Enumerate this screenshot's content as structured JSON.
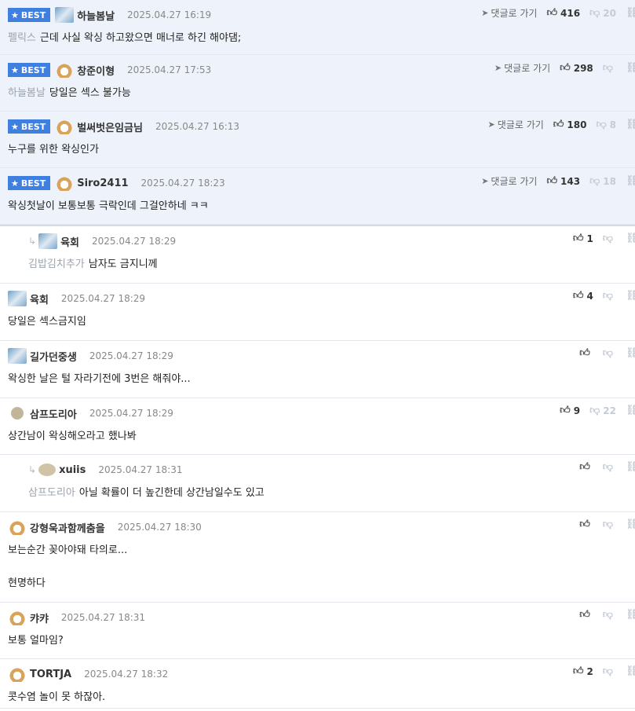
{
  "goto_label": "댓글로 가기",
  "best_label": "BEST",
  "comments": [
    {
      "best": true,
      "avatar": "bear-avatar",
      "nick": "하늘봄날",
      "date": "2025.04.27 16:19",
      "mention": "펠릭스",
      "text": "근데 사실 왁싱 하고왔으면 매너로 하긴 해야댐;",
      "likes": "416",
      "dislikes": "20"
    },
    {
      "best": true,
      "avatar": "fox-avatar",
      "nick": "창준이형",
      "date": "2025.04.27 17:53",
      "mention": "하늘봄날",
      "text": "당일은 섹스 불가능",
      "likes": "298",
      "dislikes": ""
    },
    {
      "best": true,
      "avatar": "fox-avatar",
      "nick": "벌써벗은임금님",
      "date": "2025.04.27 16:13",
      "mention": "",
      "text": "누구를 위한 왁싱인가",
      "likes": "180",
      "dislikes": "8"
    },
    {
      "best": true,
      "avatar": "fox-avatar",
      "nick": "Siro2411",
      "date": "2025.04.27 18:23",
      "mention": "",
      "text": "왁싱첫날이 보통보통 극락인데 그걸안하네 ㅋㅋ",
      "likes": "143",
      "dislikes": "18"
    },
    {
      "reply": true,
      "avatar": "bear-avatar",
      "nick": "육회",
      "date": "2025.04.27 18:29",
      "mention": "김밥김치추가",
      "text": "남자도 금지니께",
      "likes": "1",
      "dislikes": ""
    },
    {
      "avatar": "bear-avatar",
      "nick": "육회",
      "date": "2025.04.27 18:29",
      "mention": "",
      "text": "당일은 섹스금지임",
      "likes": "4",
      "dislikes": ""
    },
    {
      "avatar": "bear-avatar",
      "nick": "길가던중생",
      "date": "2025.04.27 18:29",
      "mention": "",
      "text": "왁싱한 날은 털 자라기전에 3번은 해줘야...",
      "likes": "",
      "dislikes": ""
    },
    {
      "avatar": "dot-avatar",
      "nick": "삼프도리아",
      "date": "2025.04.27 18:29",
      "mention": "",
      "text": "상간남이 왁싱해오라고 했나봐",
      "likes": "9",
      "dislikes": "22"
    },
    {
      "reply": true,
      "avatar": "egg-avatar",
      "nick": "xuiis",
      "date": "2025.04.27 18:31",
      "mention": "삼프도리아",
      "text": "아닐 확률이 더 높긴한데 상간남일수도 있고",
      "likes": "",
      "dislikes": ""
    },
    {
      "avatar": "fox-avatar",
      "nick": "강형욱과함께춤을",
      "date": "2025.04.27 18:30",
      "mention": "",
      "text": "보는순간 꽂아야돼 타의로...",
      "text2": "현명하다",
      "likes": "",
      "dislikes": ""
    },
    {
      "avatar": "fox-avatar",
      "nick": "캬캬",
      "date": "2025.04.27 18:31",
      "mention": "",
      "text": "보통 얼마임?",
      "likes": "",
      "dislikes": ""
    },
    {
      "avatar": "fox-avatar",
      "nick": "TORTJA",
      "date": "2025.04.27 18:32",
      "mention": "",
      "text": "콧수염 놀이 못 하잖아.",
      "likes": "2",
      "dislikes": ""
    }
  ]
}
